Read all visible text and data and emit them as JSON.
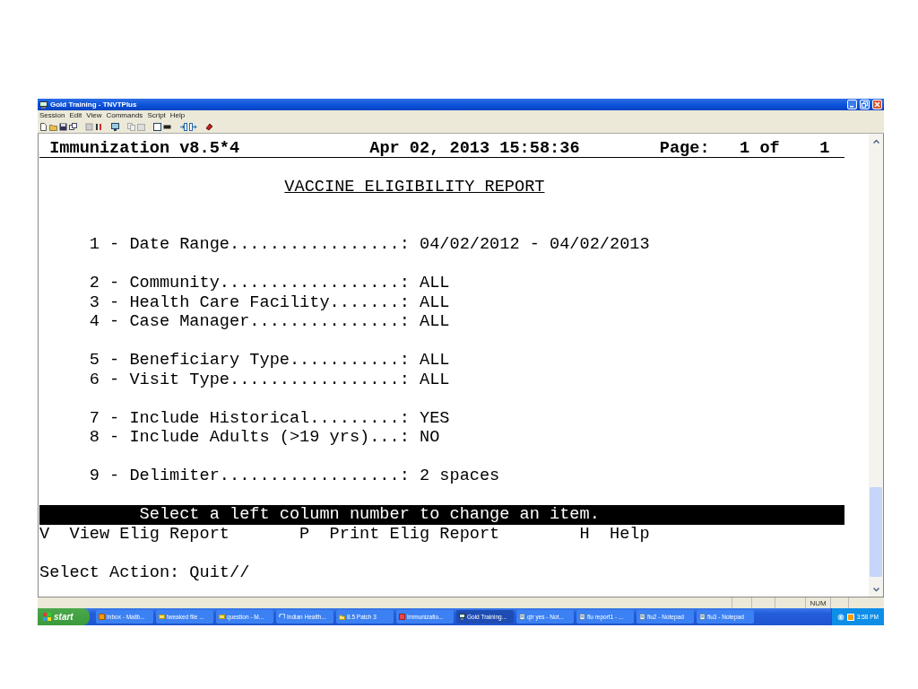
{
  "window": {
    "title": "Gold Training - TNVTPlus"
  },
  "menu": [
    "Session",
    "Edit",
    "View",
    "Commands",
    "Script",
    "Help"
  ],
  "terminal": {
    "header": {
      "app": "Immunization v8.5*4",
      "datetime": "Apr 02, 2013 15:58:36",
      "page_label": "Page:",
      "page": "1 of",
      "page_total": "1"
    },
    "report_title": "VACCINE ELIGIBILITY REPORT",
    "groups": [
      [
        "1 - Date Range.................: 04/02/2012 - 04/02/2013"
      ],
      [
        "2 - Community..................: ALL",
        "3 - Health Care Facility.......: ALL",
        "4 - Case Manager...............: ALL"
      ],
      [
        "5 - Beneficiary Type...........: ALL",
        "6 - Visit Type.................: ALL"
      ],
      [
        "7 - Include Historical.........: YES",
        "8 - Include Adults (>19 yrs)...: NO"
      ],
      [
        "9 - Delimiter..................: 2 spaces"
      ]
    ],
    "prompt_bar": "Select a left column number to change an item.",
    "actions": [
      {
        "key": "V",
        "label": "View Elig Report"
      },
      {
        "key": "P",
        "label": "Print Elig Report"
      },
      {
        "key": "H",
        "label": "Help"
      }
    ],
    "command_line": "Select Action: Quit//"
  },
  "status_bar": {
    "num": "NUM"
  },
  "taskbar": {
    "start": "start",
    "clock": "3:58 PM",
    "tasks": [
      {
        "label": "Inbox - Mailb...",
        "kind": "mail",
        "selected": false
      },
      {
        "label": "tweaked file ...",
        "kind": "note",
        "selected": false
      },
      {
        "label": "question - M...",
        "kind": "note",
        "selected": false
      },
      {
        "label": "Indian Health...",
        "kind": "browser",
        "selected": false
      },
      {
        "label": "8.5 Patch 3",
        "kind": "folder",
        "selected": false
      },
      {
        "label": "Immunizatio...",
        "kind": "doc",
        "selected": false
      },
      {
        "label": "Gold Training...",
        "kind": "terminal",
        "selected": true
      },
      {
        "label": "qtr yes - Not...",
        "kind": "notepad",
        "selected": false
      },
      {
        "label": "flu report1 - ...",
        "kind": "notepad",
        "selected": false
      },
      {
        "label": "flu2 - Notepad",
        "kind": "notepad",
        "selected": false
      },
      {
        "label": "flu3 - Notepad",
        "kind": "notepad",
        "selected": false
      }
    ]
  }
}
